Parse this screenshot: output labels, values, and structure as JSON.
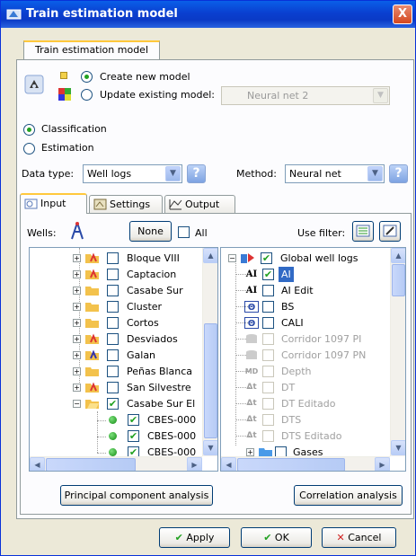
{
  "window": {
    "title": "Train estimation model",
    "close_label": "X"
  },
  "outer_tab": "Train estimation model",
  "model": {
    "create_label": "Create new model",
    "update_label": "Update existing model:",
    "existing_model_value": "Neural net 2",
    "selected": "create"
  },
  "mode": {
    "classification_label": "Classification",
    "estimation_label": "Estimation",
    "selected": "classification"
  },
  "data_type": {
    "label": "Data type:",
    "value": "Well logs"
  },
  "method": {
    "label": "Method:",
    "value": "Neural net"
  },
  "help_label": "?",
  "tabs": [
    {
      "label": "Input",
      "icon": "input-tab-icon",
      "active": true
    },
    {
      "label": "Settings",
      "icon": "settings-tab-icon",
      "active": false
    },
    {
      "label": "Output",
      "icon": "output-tab-icon",
      "active": false
    }
  ],
  "wells": {
    "label": "Wells:",
    "none_label": "None",
    "all_label": "All",
    "items": [
      {
        "name": "Bloque VIII",
        "checked": false
      },
      {
        "name": "Captacion",
        "checked": false
      },
      {
        "name": "Casabe Sur",
        "checked": false
      },
      {
        "name": "Cluster",
        "checked": false
      },
      {
        "name": "Cortos",
        "checked": false
      },
      {
        "name": "Desviados",
        "checked": false
      },
      {
        "name": "Galan",
        "checked": false
      },
      {
        "name": "Peñas Blanca",
        "checked": false
      },
      {
        "name": "San Silvestre",
        "checked": false
      },
      {
        "name": "Casabe Sur El",
        "checked": true
      },
      {
        "name": "CBES-000",
        "checked": true
      },
      {
        "name": "CBES-000",
        "checked": true
      },
      {
        "name": "CBES-000",
        "checked": true
      }
    ]
  },
  "logs": {
    "filter_label": "Use filter:",
    "root_label": "Global well logs",
    "items": [
      {
        "icon": "AI",
        "name": "AI",
        "checked": true,
        "selected": true,
        "enabled": true
      },
      {
        "icon": "AI",
        "name": "AI Edit",
        "checked": false,
        "selected": false,
        "enabled": true
      },
      {
        "icon": "caliper",
        "name": "BS",
        "checked": false,
        "selected": false,
        "enabled": true
      },
      {
        "icon": "caliper",
        "name": "CALI",
        "checked": false,
        "selected": false,
        "enabled": true
      },
      {
        "icon": "cylinder",
        "name": "Corridor 1097 PI",
        "checked": false,
        "selected": false,
        "enabled": false
      },
      {
        "icon": "cylinder",
        "name": "Corridor 1097 PN",
        "checked": false,
        "selected": false,
        "enabled": false
      },
      {
        "icon": "MD",
        "name": "Depth",
        "checked": false,
        "selected": false,
        "enabled": false
      },
      {
        "icon": "delta-t",
        "name": "DT",
        "checked": false,
        "selected": false,
        "enabled": false
      },
      {
        "icon": "delta-t",
        "name": "DT Editado",
        "checked": false,
        "selected": false,
        "enabled": false
      },
      {
        "icon": "delta-t",
        "name": "DTS",
        "checked": false,
        "selected": false,
        "enabled": false
      },
      {
        "icon": "delta-t",
        "name": "DTS Editado",
        "checked": false,
        "selected": false,
        "enabled": false
      },
      {
        "icon": "folder",
        "name": "Gases",
        "checked": false,
        "selected": false,
        "enabled": true
      }
    ]
  },
  "buttons": {
    "pca": "Principal component analysis",
    "correlation": "Correlation analysis",
    "apply": "Apply",
    "ok": "OK",
    "cancel": "Cancel"
  },
  "icon_glyphs": {
    "check": "✔",
    "exp_plus": "+",
    "exp_minus": "−",
    "ai": "AI",
    "caliper": "Θ",
    "md": "MD",
    "delta": "Δt",
    "arrow_down": "▼",
    "arrow_up": "▲",
    "arrow_left": "◀",
    "arrow_right": "▶",
    "cancel_x": "✕"
  }
}
